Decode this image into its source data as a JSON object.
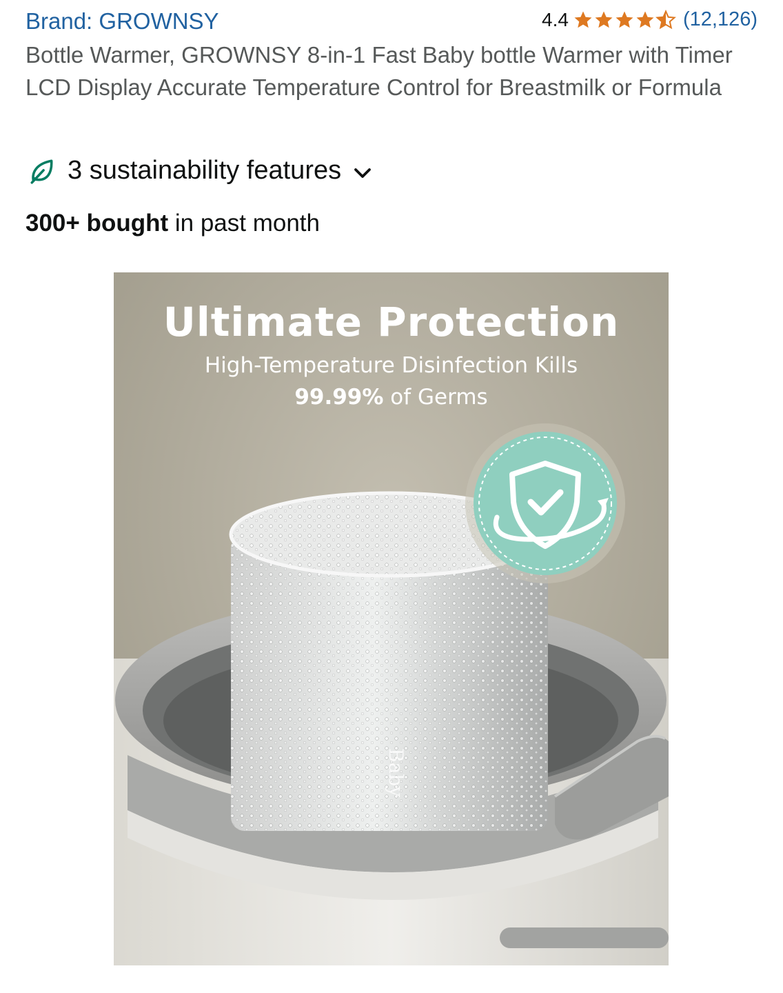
{
  "brand": {
    "label": "Brand: GROWNSY"
  },
  "rating": {
    "value": "4.4",
    "stars_filled": 4.4,
    "stars_total": 5,
    "review_count": "(12,126)",
    "star_color": "#de7921"
  },
  "product": {
    "title": "Bottle Warmer, GROWNSY 8-in-1 Fast Baby bottle Warmer with Timer LCD Display Accurate Temperature Control for Breastmilk or Formula"
  },
  "sustainability": {
    "label": "3 sustainability features",
    "icon": "leaf-icon",
    "icon_color": "#067d62"
  },
  "purchases": {
    "bold": "300+ bought",
    "rest": " in past month"
  },
  "image": {
    "headline": "Ultimate Protection",
    "subline": "High-Temperature Disinfection Kills",
    "highlight": "99.99%",
    "highlight_suffix": " of Germs",
    "badge_icon": "shield-check-icon",
    "badge_color": "#8fcfbf",
    "bottle_text": "Baby"
  },
  "colors": {
    "link": "#2162a1",
    "muted_text": "#565959",
    "body_text": "#0f1111"
  }
}
